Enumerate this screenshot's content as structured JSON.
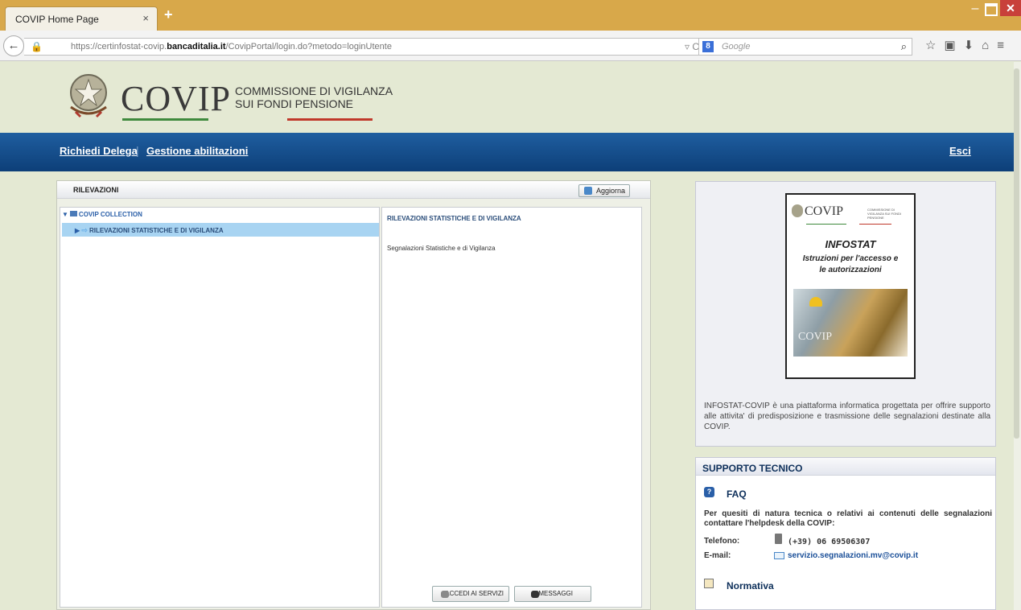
{
  "browser": {
    "tab_title": "COVIP Home Page",
    "tab_close": "×",
    "new_tab": "+",
    "url_prefix": "https://certinfostat-covip.",
    "url_domain": "bancaditalia.it",
    "url_path": "/CovipPortal/login.do?metodo=loginUtente",
    "search_engine": "8",
    "search_placeholder": "Google"
  },
  "header": {
    "logo": "COVIP",
    "subtitle_line1": "COMMISSIONE DI VIGILANZA",
    "subtitle_line2": "SUI FONDI PENSIONE"
  },
  "nav": {
    "delega": "Richiedi Delega",
    "separator": "|",
    "abilitazioni": "Gestione abilitazioni",
    "esci": "Esci"
  },
  "rilevazioni": {
    "title": "RILEVAZIONI",
    "refresh_label": "Aggiorna",
    "tree_root": "COVIP COLLECTION",
    "tree_child": "RILEVAZIONI STATISTICHE E DI VIGILANZA",
    "detail_title": "RILEVAZIONI STATISTICHE E DI VIGILANZA",
    "detail_item": "Segnalazioni Statistiche e di Vigilanza",
    "btn_accedi": "ACCEDI AI SERVIZI",
    "btn_messaggi": "MESSAGGI"
  },
  "info": {
    "cover_logo": "COVIP",
    "cover_logo_sub": "COMMISSIONE DI VIGILANZA SUI FONDI PENSIONE",
    "cover_title": "INFOSTAT",
    "cover_subtitle": "Istruzioni per l'accesso e le autorizzazioni",
    "cover_image_text": "COVIP",
    "description": "INFOSTAT-COVIP è una piattaforma informatica progettata per offrire supporto alle attivita' di predisposizione e trasmissione delle segnalazioni destinate alla COVIP."
  },
  "support": {
    "title": "SUPPORTO TECNICO",
    "faq_title": "FAQ",
    "faq_icon": "?",
    "description": "Per quesiti di natura tecnica o relativi ai contenuti delle segnalazioni contattare l'helpdesk della COVIP:",
    "tel_label": "Telefono:",
    "tel_value": "(+39) 06 69506307",
    "mail_label": "E-mail:",
    "mail_value": "servizio.segnalazioni.mv@covip.it",
    "normativa": "Normativa"
  },
  "colors": {
    "page_bg": "#e4e9d3",
    "nav_bar": "#0d3f78",
    "selection": "#a8d4f2",
    "heading_blue": "#0d2f5a"
  }
}
